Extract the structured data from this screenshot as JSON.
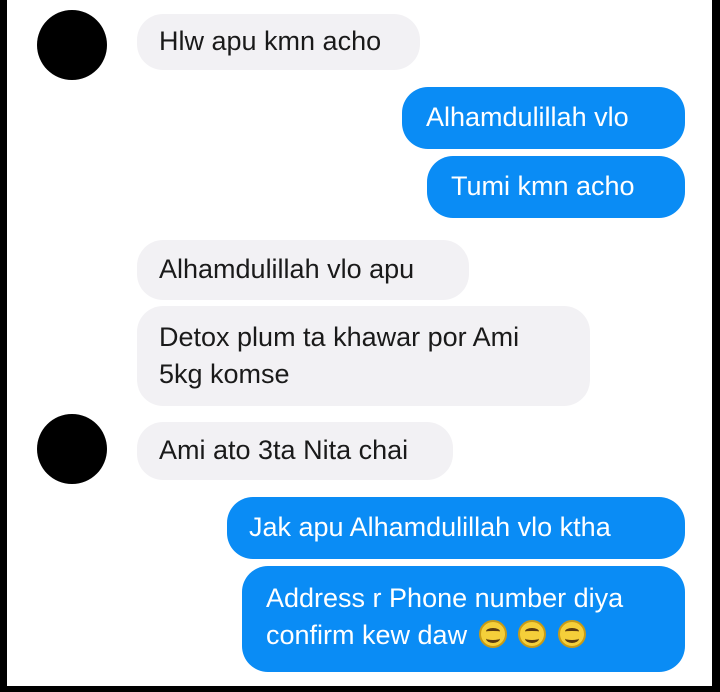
{
  "messages": {
    "m1": "Hlw apu kmn acho",
    "m2": "Alhamdulillah vlo",
    "m3": "Tumi kmn acho",
    "m4": "Alhamdulillah vlo apu",
    "m5_line1": "Detox plum ta khawar por Ami",
    "m5_line2": "5kg komse",
    "m6": "Ami ato 3ta Nita chai",
    "m7": "Jak apu Alhamdulillah vlo ktha",
    "m8_line1": "Address r Phone number diya",
    "m8_line2": "confirm kew daw"
  },
  "icons": {
    "emoji": "grinning-smile-face-emoji"
  },
  "colors": {
    "outgoing_bubble": "#0a8cf5",
    "incoming_bubble": "#f2f1f4",
    "avatar": "#000000"
  }
}
